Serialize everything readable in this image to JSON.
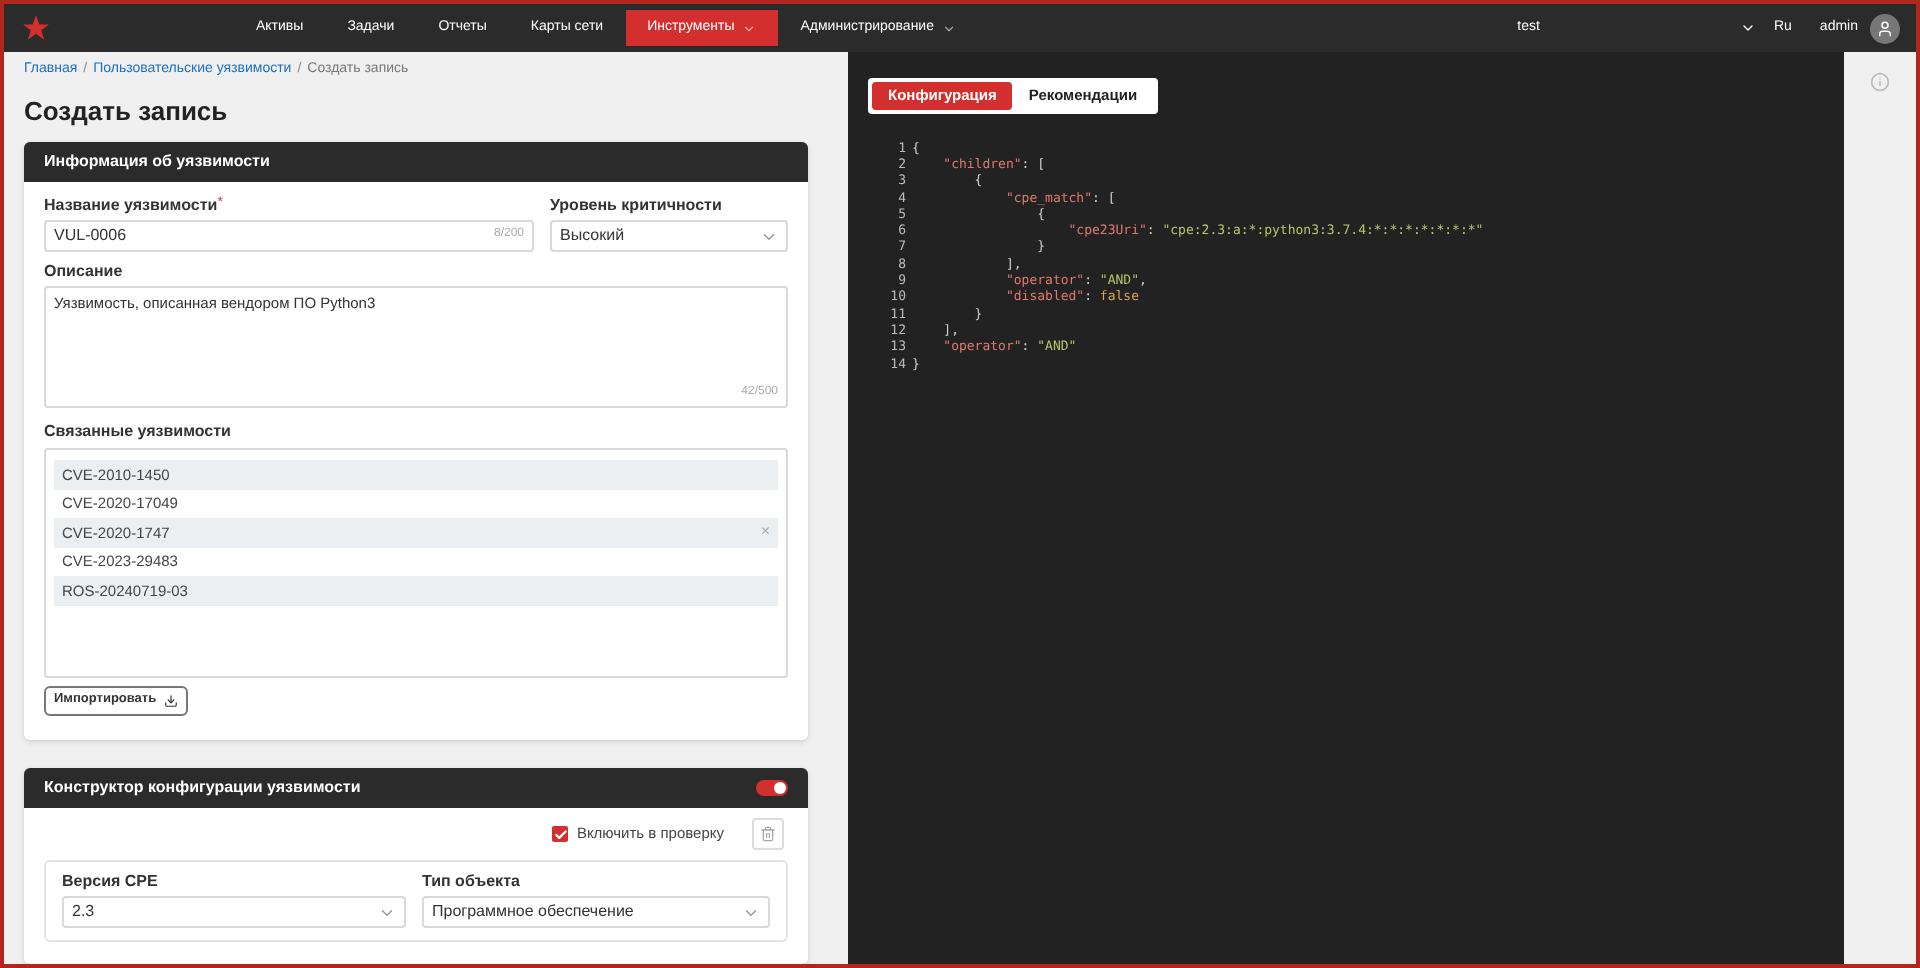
{
  "nav": {
    "items": [
      {
        "label": "Активы",
        "selected": false,
        "has_menu": false
      },
      {
        "label": "Задачи",
        "selected": false,
        "has_menu": false
      },
      {
        "label": "Отчеты",
        "selected": false,
        "has_menu": false
      },
      {
        "label": "Карты сети",
        "selected": false,
        "has_menu": false
      },
      {
        "label": "Инструменты",
        "selected": true,
        "has_menu": true
      },
      {
        "label": "Администрирование",
        "selected": false,
        "has_menu": true
      }
    ],
    "workspace": "test",
    "language": "Ru",
    "user": "admin"
  },
  "breadcrumbs": [
    {
      "label": "Главная",
      "kind": "link"
    },
    {
      "label": "Пользовательские уязвимости",
      "kind": "link"
    },
    {
      "label": "Создать запись",
      "kind": "current"
    }
  ],
  "breadcrumb_separator": "/",
  "page_title": "Создать запись",
  "info_card": {
    "title": "Информация об уязвимости",
    "name_field": {
      "label": "Название уязвимости",
      "required_mark": "*",
      "value": "VUL-0006",
      "counter": "8/200"
    },
    "severity_field": {
      "label": "Уровень критичности",
      "value": "Высокий"
    },
    "description_field": {
      "label": "Описание",
      "value": "Уязвимость, описанная вендором ПО Python3",
      "counter": "42/500"
    },
    "related": {
      "label": "Связанные уязвимости",
      "items": [
        {
          "text": "CVE-2010-1450",
          "shaded": true,
          "hovered": false
        },
        {
          "text": "CVE-2020-17049",
          "shaded": false,
          "hovered": false
        },
        {
          "text": "CVE-2020-1747",
          "shaded": true,
          "hovered": true
        },
        {
          "text": "CVE-2023-29483",
          "shaded": false,
          "hovered": false
        },
        {
          "text": "ROS-20240719-03",
          "shaded": true,
          "hovered": false
        }
      ],
      "remove_glyph": "×"
    },
    "import_button": "Импортировать"
  },
  "config_card": {
    "title": "Конструктор конфигурации уязвимости",
    "enabled": true,
    "include_checkbox": {
      "label": "Включить в проверку",
      "checked": true
    },
    "cpe_version": {
      "label": "Версия CPE",
      "value": "2.3"
    },
    "object_type": {
      "label": "Тип объекта",
      "value": "Программное обеспечение"
    }
  },
  "code_tabs": [
    {
      "label": "Конфигурация",
      "selected": true
    },
    {
      "label": "Рекомендации",
      "selected": false
    }
  ],
  "code_lines": [
    {
      "number": "1",
      "tokens": [
        {
          "kind": "punct",
          "text": "{"
        }
      ]
    },
    {
      "number": "2",
      "tokens": [
        {
          "kind": "key",
          "text": "    \"children\""
        },
        {
          "kind": "punct",
          "text": ": ["
        }
      ]
    },
    {
      "number": "3",
      "tokens": [
        {
          "kind": "punct",
          "text": "        {"
        }
      ]
    },
    {
      "number": "4",
      "tokens": [
        {
          "kind": "key",
          "text": "            \"cpe_match\""
        },
        {
          "kind": "punct",
          "text": ": ["
        }
      ]
    },
    {
      "number": "5",
      "tokens": [
        {
          "kind": "punct",
          "text": "                {"
        }
      ]
    },
    {
      "number": "6",
      "tokens": [
        {
          "kind": "key",
          "text": "                    \"cpe23Uri\""
        },
        {
          "kind": "punct",
          "text": ": "
        },
        {
          "kind": "string",
          "text": "\"cpe:2.3:a:*:python3:3.7.4:*:*:*:*:*:*:*\""
        }
      ]
    },
    {
      "number": "7",
      "tokens": [
        {
          "kind": "punct",
          "text": "                }"
        }
      ]
    },
    {
      "number": "8",
      "tokens": [
        {
          "kind": "punct",
          "text": "            ],"
        }
      ]
    },
    {
      "number": "9",
      "tokens": [
        {
          "kind": "key",
          "text": "            \"operator\""
        },
        {
          "kind": "punct",
          "text": ": "
        },
        {
          "kind": "string",
          "text": "\"AND\""
        },
        {
          "kind": "punct",
          "text": ","
        }
      ]
    },
    {
      "number": "10",
      "tokens": [
        {
          "kind": "key",
          "text": "            \"disabled\""
        },
        {
          "kind": "punct",
          "text": ": "
        },
        {
          "kind": "literal",
          "text": "false"
        }
      ]
    },
    {
      "number": "11",
      "tokens": [
        {
          "kind": "punct",
          "text": "        }"
        }
      ]
    },
    {
      "number": "12",
      "tokens": [
        {
          "kind": "punct",
          "text": "    ],"
        }
      ]
    },
    {
      "number": "13",
      "tokens": [
        {
          "kind": "key",
          "text": "    \"operator\""
        },
        {
          "kind": "punct",
          "text": ": "
        },
        {
          "kind": "string",
          "text": "\"AND\""
        }
      ]
    },
    {
      "number": "14",
      "tokens": [
        {
          "kind": "punct",
          "text": "}"
        }
      ]
    }
  ]
}
